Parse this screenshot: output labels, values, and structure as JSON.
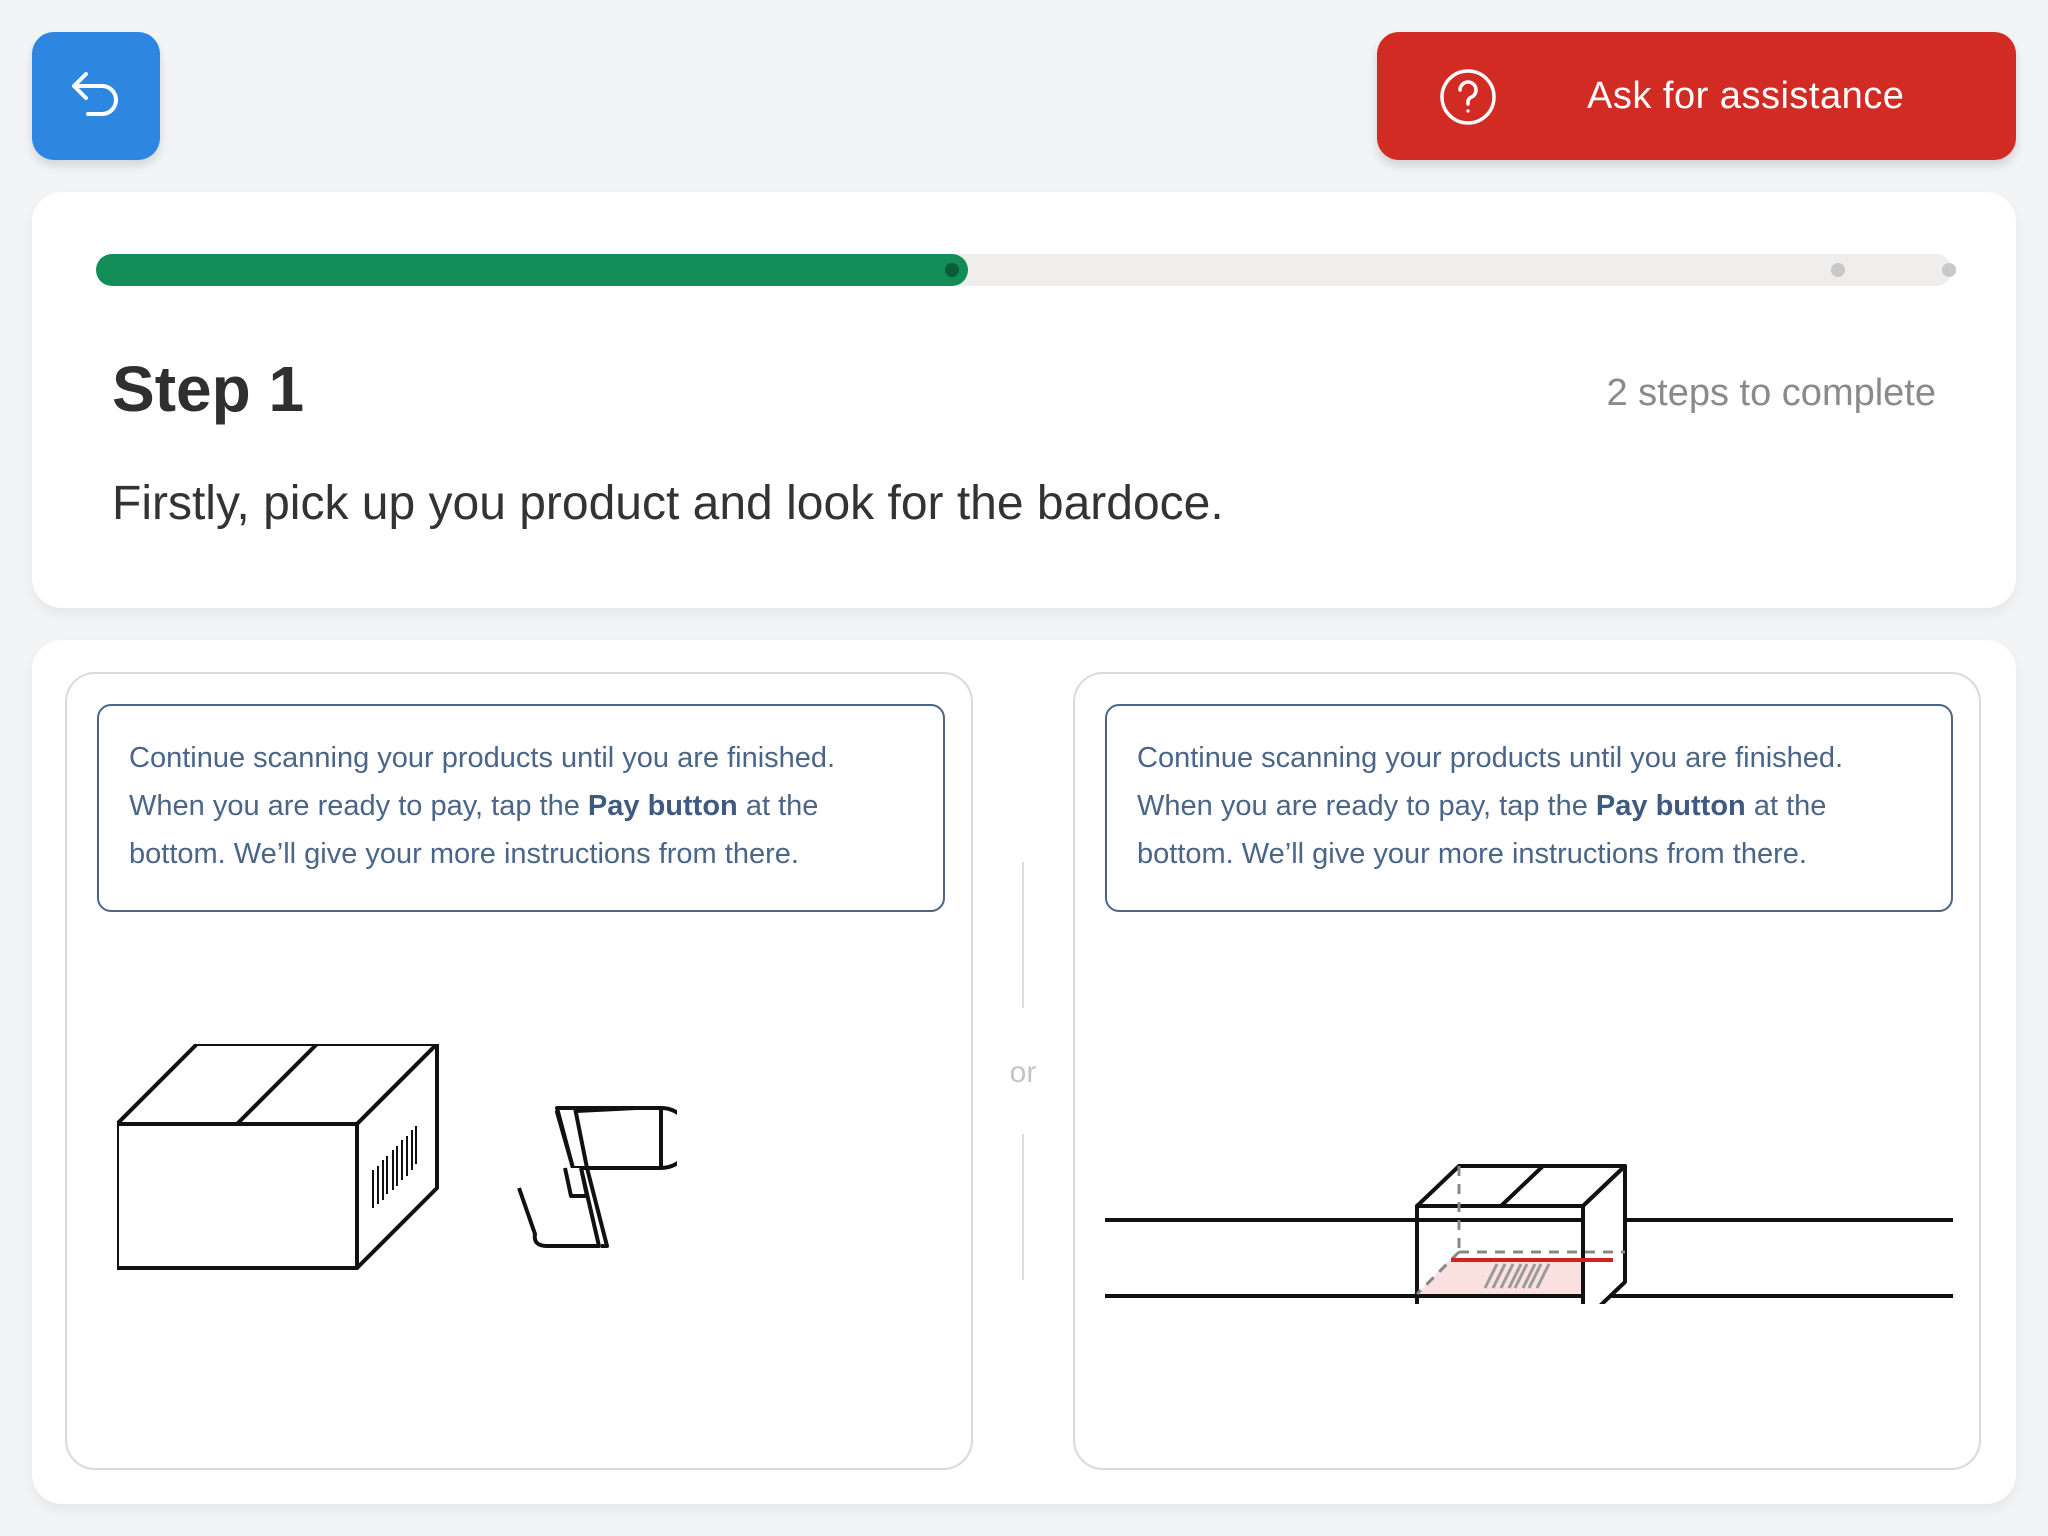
{
  "header": {
    "back_icon": "undo-arrow-icon",
    "assist": {
      "label": "Ask for assistance",
      "icon": "question-circle-icon"
    }
  },
  "step": {
    "title": "Step 1",
    "count_text": "2 steps to complete",
    "description": "Firstly, pick up you product and look for the bardoce.",
    "progress": {
      "fraction": 0.47,
      "total_steps": 2
    }
  },
  "options": [
    {
      "text_1": "Continue scanning your products until you are finished. When you are ready to pay, tap the",
      "text_bold": "Pay button",
      "text_2": "at the bottom. We’ll give your more instructions from there.",
      "illustration": "box-and-handheld-scanner-icon"
    },
    {
      "text_1": "Continue scanning your products until you are finished. When you are ready to pay, tap the",
      "text_bold": "Pay button",
      "text_2": "at the bottom. We’ll give your more instructions from there.",
      "illustration": "box-on-flatbed-scanner-icon"
    }
  ],
  "separator": {
    "label": "or"
  },
  "colors": {
    "back": "#2d87e0",
    "assist": "#d22b24",
    "progress_fill": "#138d58",
    "info_text": "#4b6589",
    "scan_line": "#d42020"
  }
}
